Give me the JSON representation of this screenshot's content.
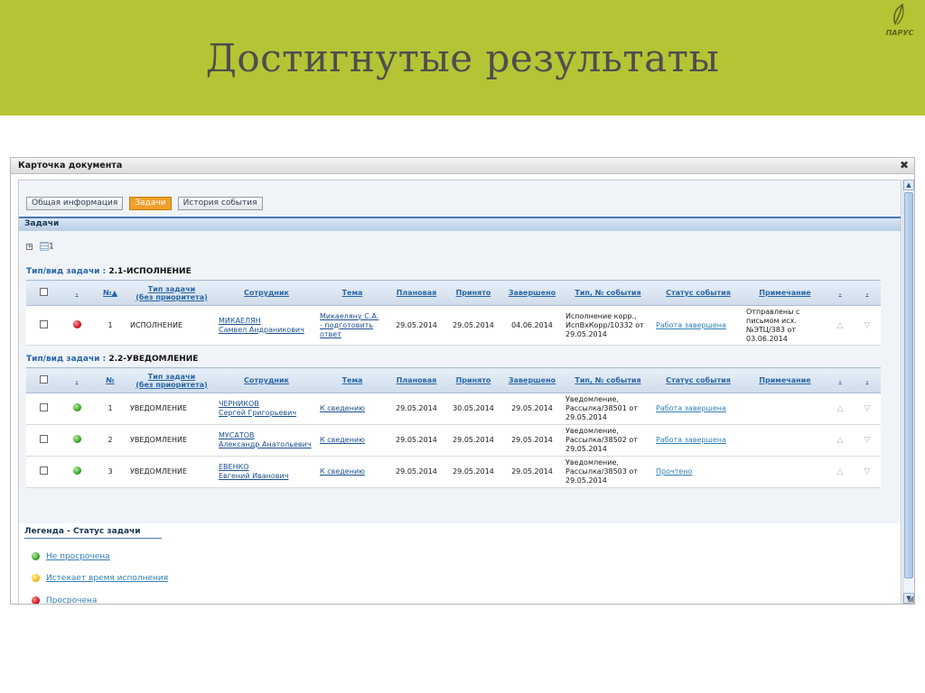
{
  "slide": {
    "title": "Достигнутые результаты",
    "logo_text": "ПАРУС"
  },
  "window": {
    "title": "Карточка документа",
    "close_glyph": "✖"
  },
  "tabs": [
    {
      "label": "Общая информация",
      "active": false
    },
    {
      "label": "Задачи",
      "active": true
    },
    {
      "label": "История события",
      "active": false
    }
  ],
  "section": {
    "title": "Задачи"
  },
  "tree": {
    "count": "1"
  },
  "columns": {
    "dot": ".",
    "num": "№",
    "task_type_line1": "Тип задачи",
    "task_type_line2": "(без приоритета)",
    "employee": "Сотрудник",
    "subject": "Тема",
    "planned": "Плановая",
    "accepted": "Принято",
    "completed": "Завершено",
    "event_type": "Тип, № события",
    "event_status": "Статус события",
    "note": "Примечание",
    "extra1": ".",
    "extra2": "."
  },
  "sort_glyph": "▲",
  "groups": [
    {
      "label_prefix": "Тип/вид задачи :",
      "label_value": "2.1-ИСПОЛНЕНИЕ",
      "rows": [
        {
          "status": "red",
          "num": "1",
          "task_type": "ИСПОЛНЕНИЕ",
          "employee_line1": "МИКАЕЛЯН",
          "employee_line2": "Самвел Андраникович",
          "subject_line1": "Микаеляну С.А.",
          "subject_line2": "- подготовить",
          "subject_line3": "ответ",
          "planned": "29.05.2014",
          "accepted": "29.05.2014",
          "completed": "04.06.2014",
          "event_line1": "Исполнение корр.,",
          "event_line2": "ИспВхКорр/10332 от",
          "event_line3": "29.05.2014",
          "event_status": "Работа завершена",
          "note_line1": "Отправлены с",
          "note_line2": "письмом исх.",
          "note_line3": "№ЭТЦ/383 от",
          "note_line4": "03.06.2014"
        }
      ]
    },
    {
      "label_prefix": "Тип/вид задачи :",
      "label_value": "2.2-УВЕДОМЛЕНИЕ",
      "rows": [
        {
          "status": "green",
          "num": "1",
          "task_type": "УВЕДОМЛЕНИЕ",
          "employee_line1": "ЧЕРНИКОВ",
          "employee_line2": "Сергей Григорьевич",
          "subject_line1": "К сведению",
          "planned": "29.05.2014",
          "accepted": "30.05.2014",
          "completed": "29.05.2014",
          "event_line1": "Уведомление,",
          "event_line2": "Рассылка/38501 от",
          "event_line3": "29.05.2014",
          "event_status": "Работа завершена"
        },
        {
          "status": "green",
          "num": "2",
          "task_type": "УВЕДОМЛЕНИЕ",
          "employee_line1": "МУСАТОВ",
          "employee_line2": "Александр Анатольевич",
          "subject_line1": "К сведению",
          "planned": "29.05.2014",
          "accepted": "29.05.2014",
          "completed": "29.05.2014",
          "event_line1": "Уведомление,",
          "event_line2": "Рассылка/38502 от",
          "event_line3": "29.05.2014",
          "event_status": "Работа завершена"
        },
        {
          "status": "green",
          "num": "3",
          "task_type": "УВЕДОМЛЕНИЕ",
          "employee_line1": "ЕВЕНКО",
          "employee_line2": "Евгений Иванович",
          "subject_line1": "К сведению",
          "planned": "29.05.2014",
          "accepted": "29.05.2014",
          "completed": "29.05.2014",
          "event_line1": "Уведомление,",
          "event_line2": "Рассылка/38503 от",
          "event_line3": "29.05.2014",
          "event_status": "Прочтено"
        }
      ]
    }
  ],
  "legend": {
    "title": "Легенда - Статус задачи",
    "items": [
      {
        "color": "green",
        "label": "Не просрочена"
      },
      {
        "color": "yellow",
        "label": "Истекает время исполнения"
      },
      {
        "color": "red",
        "label": "Просрочена"
      }
    ]
  },
  "icons": {
    "row_up": "triangle-up-icon",
    "row_down": "triangle-down-icon",
    "close": "close-icon",
    "expand": "plus-box-icon"
  }
}
